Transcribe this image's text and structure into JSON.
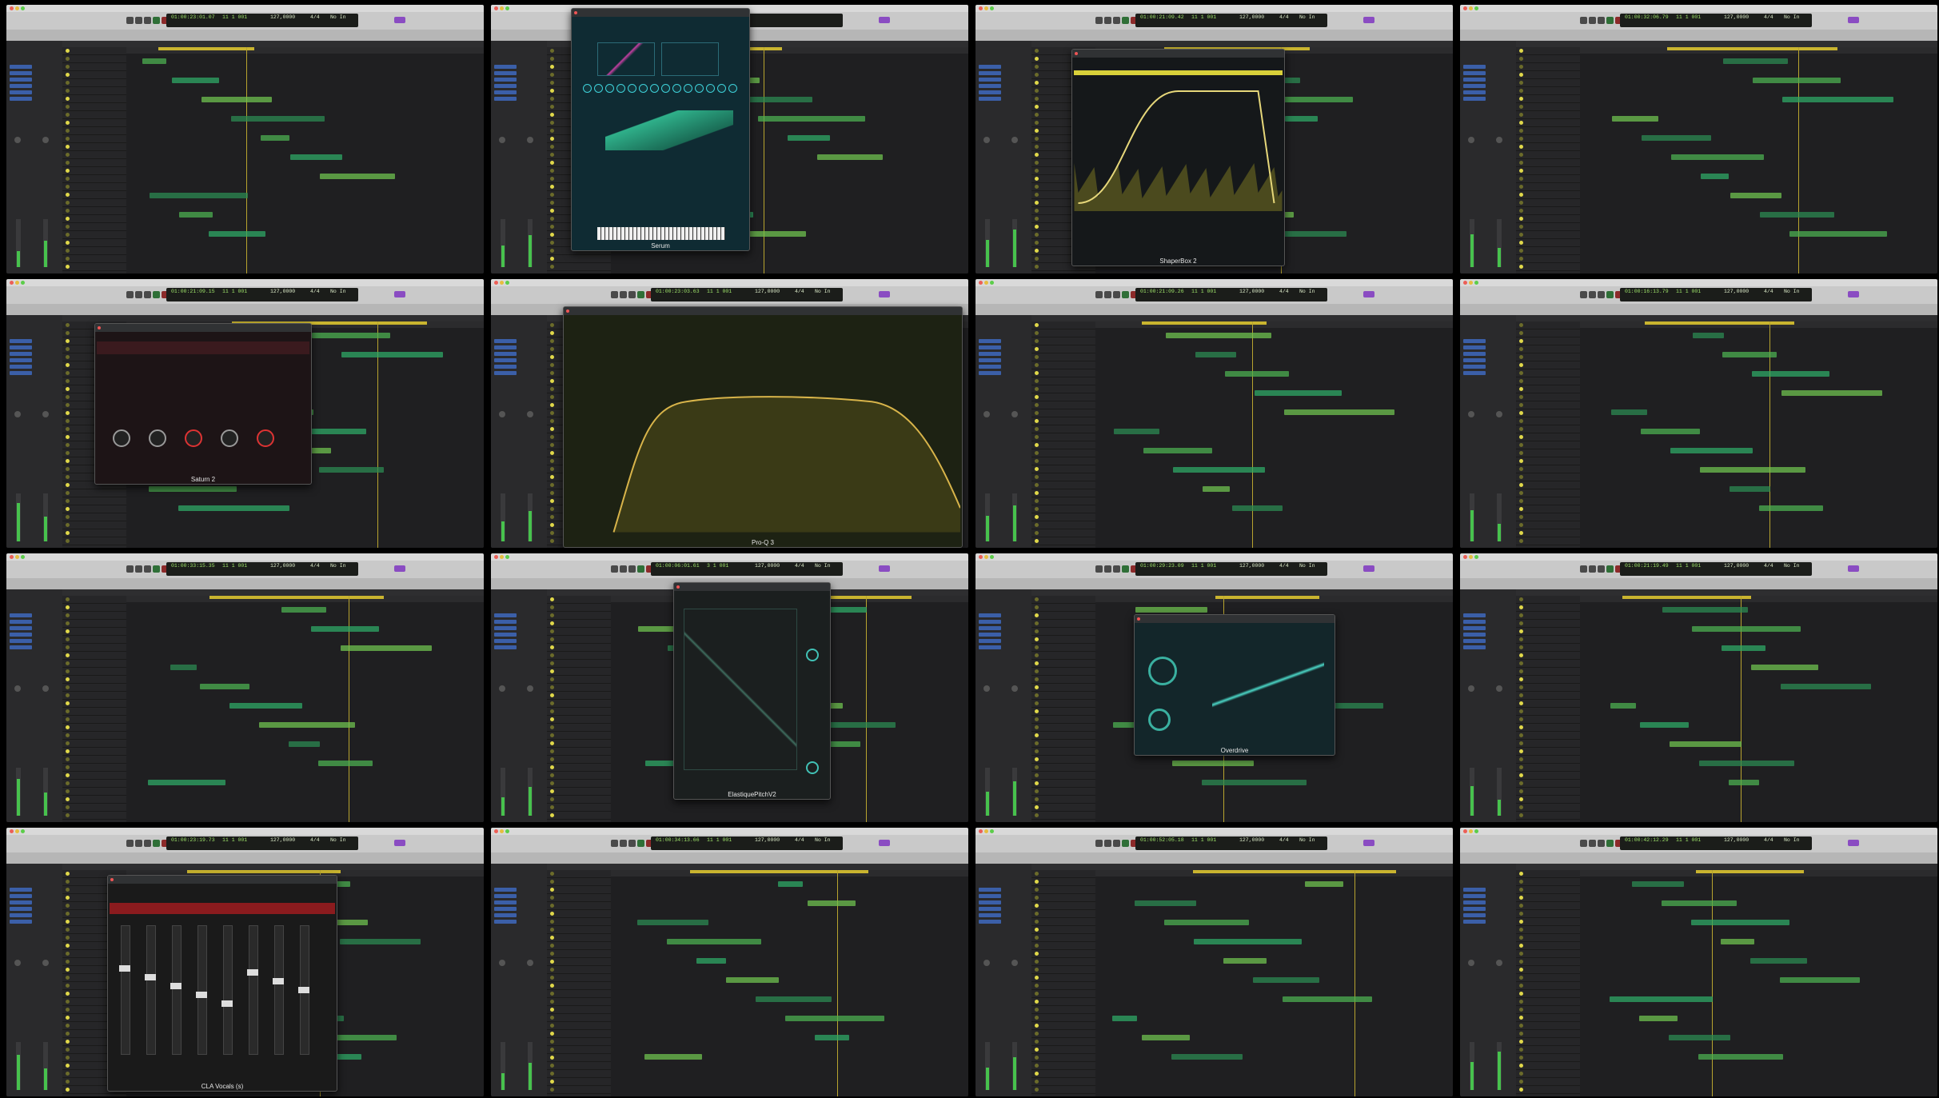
{
  "grid": {
    "cols": 4,
    "accent": "#c9b42f",
    "lcd_color": "#9ee36a",
    "tiles": [
      {
        "position": "01:00:23:01.07",
        "bar": "11 1 001",
        "tempo": "127,0000",
        "signature": "4/4",
        "key": "No In",
        "plugin": null,
        "theme": "default"
      },
      {
        "position": "",
        "bar": "",
        "tempo": "",
        "signature": "",
        "key": "",
        "plugin": "Serum",
        "theme": "serum"
      },
      {
        "position": "01:00:21:09.42",
        "bar": "11 1 001",
        "tempo": "127,0000",
        "signature": "4/4",
        "key": "No In",
        "plugin": "ShaperBox 2",
        "theme": "shaper"
      },
      {
        "position": "01:00:32:06.79",
        "bar": "11 1 001",
        "tempo": "127,0000",
        "signature": "4/4",
        "key": "No In",
        "plugin": null,
        "theme": "default"
      },
      {
        "position": "01:00:21:09.15",
        "bar": "11 1 001",
        "tempo": "127,0000",
        "signature": "4/4",
        "key": "No In",
        "plugin": "Saturn 2",
        "theme": "saturn"
      },
      {
        "position": "01:00:23:03.63",
        "bar": "11 1 001",
        "tempo": "127,0000",
        "signature": "4/4",
        "key": "No In",
        "plugin": "Pro-Q 3",
        "theme": "proq"
      },
      {
        "position": "01:00:21:09.26",
        "bar": "11 1 001",
        "tempo": "127,0000",
        "signature": "4/4",
        "key": "No In",
        "plugin": null,
        "theme": "default"
      },
      {
        "position": "01:00:16:13.79",
        "bar": "11 1 001",
        "tempo": "127,0000",
        "signature": "4/4",
        "key": "No In",
        "plugin": null,
        "theme": "default"
      },
      {
        "position": "01:00:33:15.35",
        "bar": "11 1 001",
        "tempo": "127,0000",
        "signature": "4/4",
        "key": "No In",
        "plugin": null,
        "theme": "default"
      },
      {
        "position": "01:00:06:01.61",
        "bar": "3 1 001",
        "tempo": "127,0000",
        "signature": "4/4",
        "key": "No In",
        "plugin": "ElastiquePitchV2",
        "theme": "elastique"
      },
      {
        "position": "01:00:29:23.09",
        "bar": "11 1 001",
        "tempo": "127,0000",
        "signature": "4/4",
        "key": "No In",
        "plugin": "Overdrive",
        "theme": "overdrive"
      },
      {
        "position": "01:00:21:19.49",
        "bar": "11 1 001",
        "tempo": "127,0000",
        "signature": "4/4",
        "key": "No In",
        "plugin": null,
        "theme": "default"
      },
      {
        "position": "01:00:23:19.73",
        "bar": "11 1 001",
        "tempo": "127,0000",
        "signature": "4/4",
        "key": "No In",
        "plugin": "CLA Vocals (s)",
        "theme": "cla"
      },
      {
        "position": "01:00:34:13.66",
        "bar": "11 1 001",
        "tempo": "127,0000",
        "signature": "4/4",
        "key": "No In",
        "plugin": null,
        "theme": "default"
      },
      {
        "position": "01:00:52:05.18",
        "bar": "11 1 001",
        "tempo": "127,0000",
        "signature": "4/4",
        "key": "No In",
        "plugin": null,
        "theme": "default"
      },
      {
        "position": "01:00:42:12.29",
        "bar": "11 1 001",
        "tempo": "127,0000",
        "signature": "4/4",
        "key": "No In",
        "plugin": null,
        "theme": "default"
      }
    ]
  }
}
